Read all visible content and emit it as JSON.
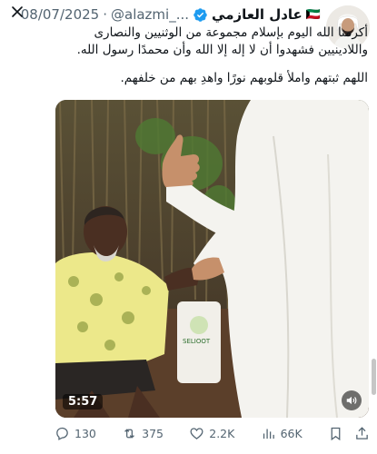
{
  "post": {
    "author_name": "عادل العازمي",
    "flag": "🇰🇼",
    "handle": "@alazmi_...",
    "separator": "·",
    "date": "08/07/2025",
    "paragraphs": [
      "أكرمنا الله اليوم بإسلام مجموعة من الوثنيين والنصارى واللادينيين فشهدوا أن لا إله إلا الله وأن محمدًا رسول الله.",
      "اللهم ثبتهم واملأ قلوبهم نورًا واهدِ بهم من خلفهم."
    ]
  },
  "video": {
    "timecode": "5:57",
    "bag_text": "SELIOOT"
  },
  "actions": {
    "replies": "130",
    "reposts": "375",
    "likes": "2.2K",
    "views": "66K"
  },
  "colors": {
    "verified": "#1d9bf0",
    "text": "#0f1419",
    "muted": "#536471"
  },
  "icons": [
    "verified-icon",
    "more-icon",
    "reply-icon",
    "repost-icon",
    "like-icon",
    "views-icon",
    "bookmark-icon",
    "share-icon",
    "sound-icon"
  ]
}
